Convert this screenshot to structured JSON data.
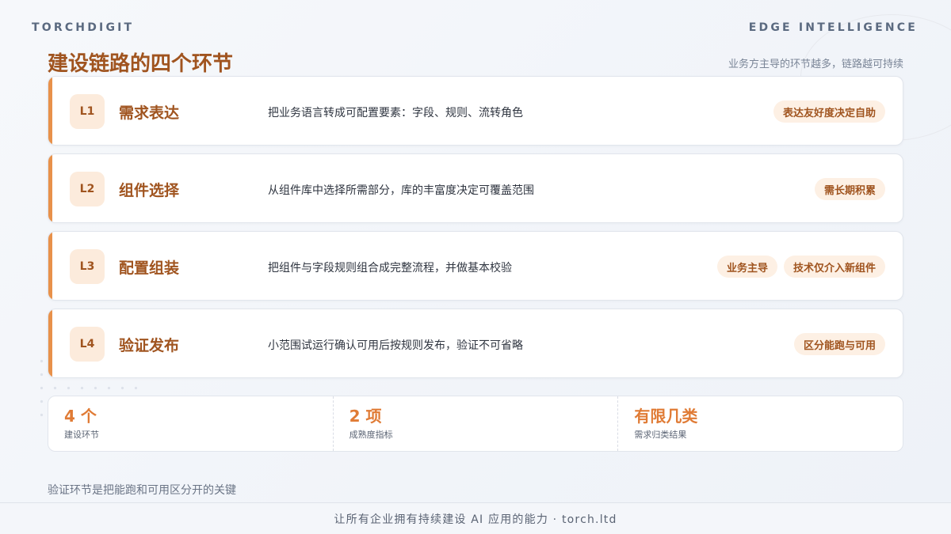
{
  "header": {
    "brand_left": "TORCHDIGIT",
    "brand_right": "EDGE INTELLIGENCE",
    "title": "建设链路的四个环节",
    "subtitle": "业务方主导的环节越多，链路越可持续"
  },
  "steps": [
    {
      "badge": "L1",
      "title": "需求表达",
      "desc": "把业务语言转成可配置要素：字段、规则、流转角色",
      "tags": [
        "表达友好度决定自助"
      ]
    },
    {
      "badge": "L2",
      "title": "组件选择",
      "desc": "从组件库中选择所需部分，库的丰富度决定可覆盖范围",
      "tags": [
        "需长期积累"
      ]
    },
    {
      "badge": "L3",
      "title": "配置组装",
      "desc": "把组件与字段规则组合成完整流程，并做基本校验",
      "tags": [
        "业务主导",
        "技术仅介入新组件"
      ]
    },
    {
      "badge": "L4",
      "title": "验证发布",
      "desc": "小范围试运行确认可用后按规则发布，验证不可省略",
      "tags": [
        "区分能跑与可用"
      ]
    }
  ],
  "stats": [
    {
      "value": "4 个",
      "label": "建设环节"
    },
    {
      "value": "2 项",
      "label": "成熟度指标"
    },
    {
      "value": "有限几类",
      "label": "需求归类结果"
    }
  ],
  "bottom_note": "验证环节是把能跑和可用区分开的关键",
  "footer": {
    "text": "让所有企业拥有持续建设 AI 应用的能力 · torch.ltd"
  },
  "colors": {
    "accent": "#e8914a",
    "title": "#a0541f",
    "stat_value": "#e07b35"
  }
}
